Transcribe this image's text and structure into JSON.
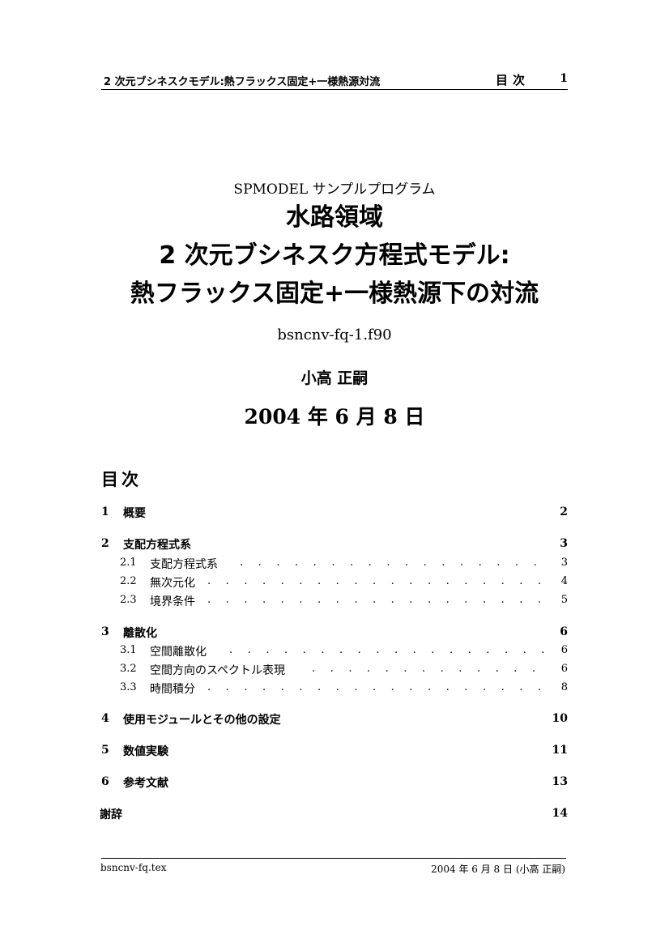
{
  "header": {
    "running_title": "2 次元ブシネスクモデル:熱フラックス固定+一様熱源対流",
    "section_label": "目次",
    "page_number": "1"
  },
  "title_block": {
    "series": "SPMODEL サンプルプログラム",
    "title_line1": "水路領域",
    "title_line2": "2 次元ブシネスク方程式モデル:",
    "title_line3": "熱フラックス固定+一様熱源下の対流",
    "filename": "bsncnv-fq-1.f90",
    "author": "小高 正嗣",
    "date": "2004 年 6 月 8 日"
  },
  "toc": {
    "heading": "目次",
    "sections": [
      {
        "num": "1",
        "title": "概要",
        "page": "2",
        "subs": []
      },
      {
        "num": "2",
        "title": "支配方程式系",
        "page": "3",
        "subs": [
          {
            "num": "2.1",
            "title": "支配方程式系",
            "page": "3"
          },
          {
            "num": "2.2",
            "title": "無次元化",
            "page": "4"
          },
          {
            "num": "2.3",
            "title": "境界条件",
            "page": "5"
          }
        ]
      },
      {
        "num": "3",
        "title": "離散化",
        "page": "6",
        "subs": [
          {
            "num": "3.1",
            "title": "空間離散化",
            "page": "6"
          },
          {
            "num": "3.2",
            "title": "空間方向のスペクトル表現",
            "page": "6"
          },
          {
            "num": "3.3",
            "title": "時間積分",
            "page": "8"
          }
        ]
      },
      {
        "num": "4",
        "title": "使用モジュールとその他の設定",
        "page": "10",
        "subs": []
      },
      {
        "num": "5",
        "title": "数値実験",
        "page": "11",
        "subs": []
      },
      {
        "num": "6",
        "title": "参考文献",
        "page": "13",
        "subs": []
      }
    ],
    "acknowledgement": {
      "title": "謝辞",
      "page": "14"
    }
  },
  "footer": {
    "left": "bsncnv-fq.tex",
    "right": "2004 年 6 月 8 日 (小高 正嗣)"
  }
}
